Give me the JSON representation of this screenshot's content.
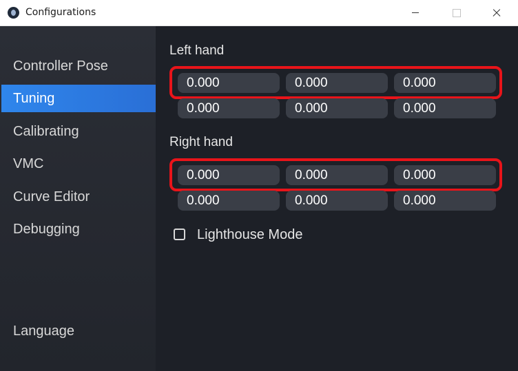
{
  "window": {
    "title": "Configurations"
  },
  "sidebar": {
    "items": [
      {
        "label": "Controller Pose",
        "active": false
      },
      {
        "label": "Tuning",
        "active": true
      },
      {
        "label": "Calibrating",
        "active": false
      },
      {
        "label": "VMC",
        "active": false
      },
      {
        "label": "Curve Editor",
        "active": false
      },
      {
        "label": "Debugging",
        "active": false
      }
    ],
    "language_label": "Language"
  },
  "left_hand": {
    "label": "Left hand",
    "row1": [
      "0.000",
      "0.000",
      "0.000"
    ],
    "row2": [
      "0.000",
      "0.000",
      "0.000"
    ]
  },
  "right_hand": {
    "label": "Right hand",
    "row1": [
      "0.000",
      "0.000",
      "0.000"
    ],
    "row2": [
      "0.000",
      "0.000",
      "0.000"
    ]
  },
  "lighthouse": {
    "label": "Lighthouse Mode",
    "checked": false
  },
  "colors": {
    "accent": "#2f86ec",
    "highlight": "#e8141a"
  }
}
